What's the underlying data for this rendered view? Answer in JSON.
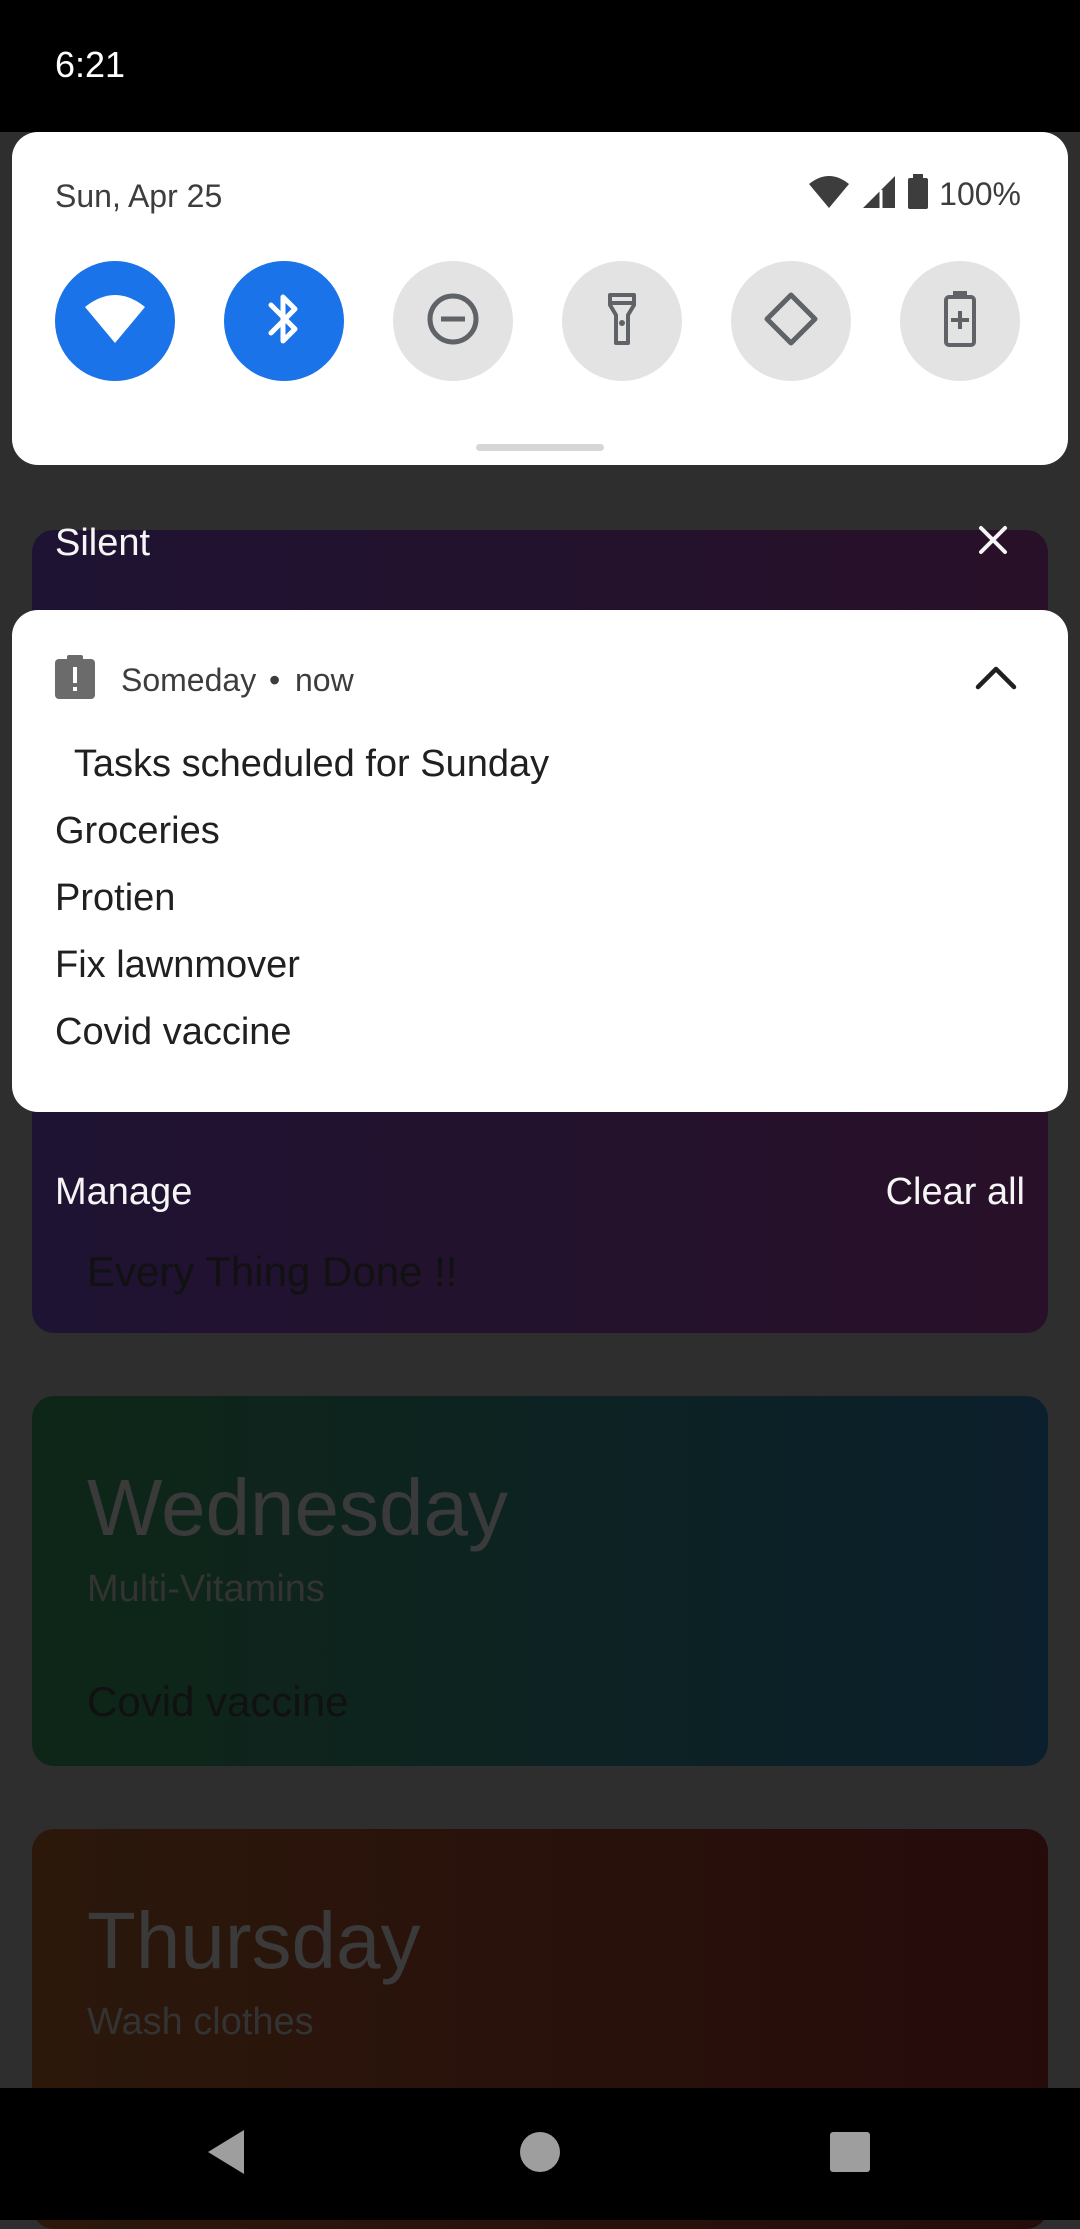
{
  "status_bar": {
    "time": "6:21"
  },
  "quick_settings": {
    "date": "Sun, Apr 25",
    "battery_text": "100%",
    "tiles": [
      {
        "icon": "wifi-icon",
        "state": "on"
      },
      {
        "icon": "bluetooth-icon",
        "state": "on"
      },
      {
        "icon": "do-not-disturb-icon",
        "state": "off"
      },
      {
        "icon": "flashlight-icon",
        "state": "off"
      },
      {
        "icon": "auto-rotate-icon",
        "state": "off"
      },
      {
        "icon": "battery-saver-icon",
        "state": "off"
      }
    ]
  },
  "silent_section": {
    "label": "Silent"
  },
  "notification": {
    "app_name": "Someday",
    "separator": "•",
    "time": "now",
    "title": " Tasks scheduled for Sunday",
    "lines": [
      "Groceries",
      "Protien",
      "Fix lawnmover",
      "Covid vaccine"
    ]
  },
  "shade_actions": {
    "manage": "Manage",
    "clear_all": "Clear all"
  },
  "background_app": {
    "cards": [
      {
        "task": "Every Thing Done !!"
      },
      {
        "day": "Wednesday",
        "subtitle": "Multi-Vitamins",
        "task": "Covid vaccine"
      },
      {
        "day": "Thursday",
        "subtitle": "Wash clothes"
      }
    ]
  },
  "colors": {
    "accent": "#1a73e8",
    "tile_off": "#e3e3e3",
    "shade_background": "#2e2e2e"
  }
}
